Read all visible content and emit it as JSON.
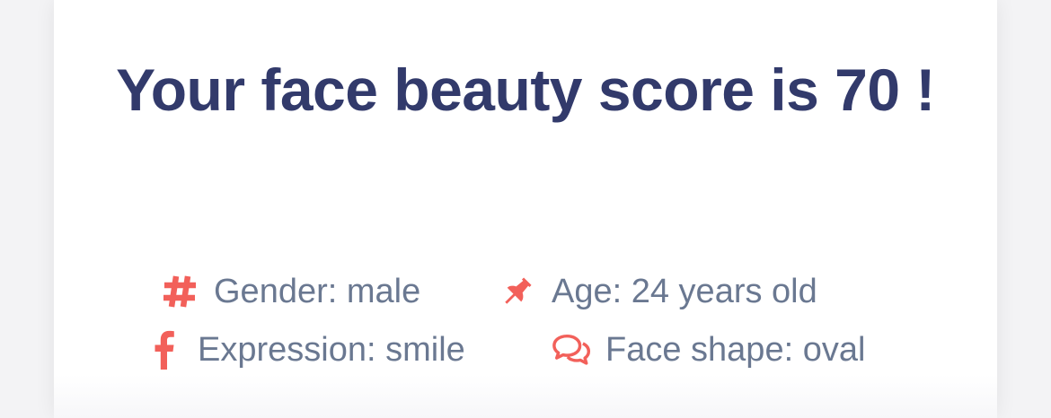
{
  "result": {
    "title": "Your face beauty score is 70 !",
    "score": 70
  },
  "facts": [
    {
      "icon": "hashtag-icon",
      "label": "Gender: male"
    },
    {
      "icon": "pushpin-icon",
      "label": "Age: 24 years old"
    },
    {
      "icon": "facebook-f-icon",
      "label": "Expression: smile"
    },
    {
      "icon": "chat-bubbles-icon",
      "label": "Face shape: oval"
    }
  ],
  "colors": {
    "title": "#323a6b",
    "icon": "#f2605a",
    "text": "#6a7891",
    "card": "#ffffff",
    "background": "#f3f3f5"
  }
}
